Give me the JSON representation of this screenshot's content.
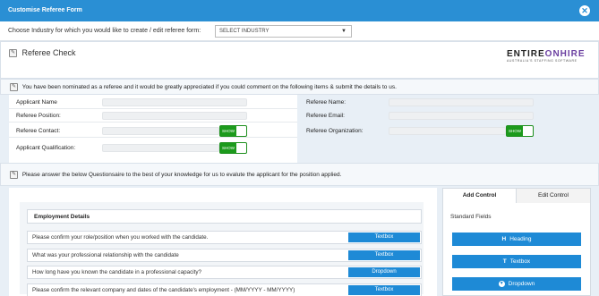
{
  "window": {
    "title": "Customise Referee Form",
    "close_icon": "close-icon"
  },
  "industry": {
    "label": "Choose Industry for which you would like to create / edit referee form:",
    "selected": "SELECT INDUSTRY"
  },
  "referee_check": {
    "heading": "Referee Check",
    "logo": {
      "brand_main": "ENTIRE",
      "brand_accent": "ONHIRE",
      "tagline": "AUSTRALIA'S STAFFING SOFTWARE"
    }
  },
  "nomination_text": "You have been nominated as a referee and it would be greatly appreciated if you could comment on the following items & submit the details to us.",
  "left_fields": [
    {
      "label": "Applicant Name"
    },
    {
      "label": "Referee Position:"
    },
    {
      "label": "Referee Contact:",
      "toggle": "SHOW"
    },
    {
      "label": "Applicant Qualification:",
      "toggle": "SHOW"
    }
  ],
  "right_fields": [
    {
      "label": "Referee Name:"
    },
    {
      "label": "Referee Email:"
    },
    {
      "label": "Referee Organization:",
      "toggle": "SHOW"
    }
  ],
  "questionnaire_text": "Please answer the below Questionsaire to the best of your knowledge for us to evalute the applicant for the position applied.",
  "section": {
    "title": "Employment Details",
    "questions": [
      {
        "text": "Please confirm your role/position when you worked with the candidate.",
        "type": "Textbox"
      },
      {
        "text": "What was your professional relationship with the candidate",
        "type": "Textbox"
      },
      {
        "text": "How long have you known the candidate in a professional capacity?",
        "type": "Dropdown"
      },
      {
        "text": "Please confirm the relevant company and dates of the candidate's employment - (MM/YYYY - MM/YYYY)",
        "type": "Textbox"
      }
    ]
  },
  "sidebar": {
    "tabs": [
      {
        "label": "Add Control"
      },
      {
        "label": "Edit Control"
      }
    ],
    "group_label": "Standard Fields",
    "controls": [
      {
        "icon": "H",
        "label": "Heading"
      },
      {
        "icon": "T",
        "label": "Textbox"
      },
      {
        "icon": "▼",
        "label": "Dropdown"
      }
    ]
  }
}
